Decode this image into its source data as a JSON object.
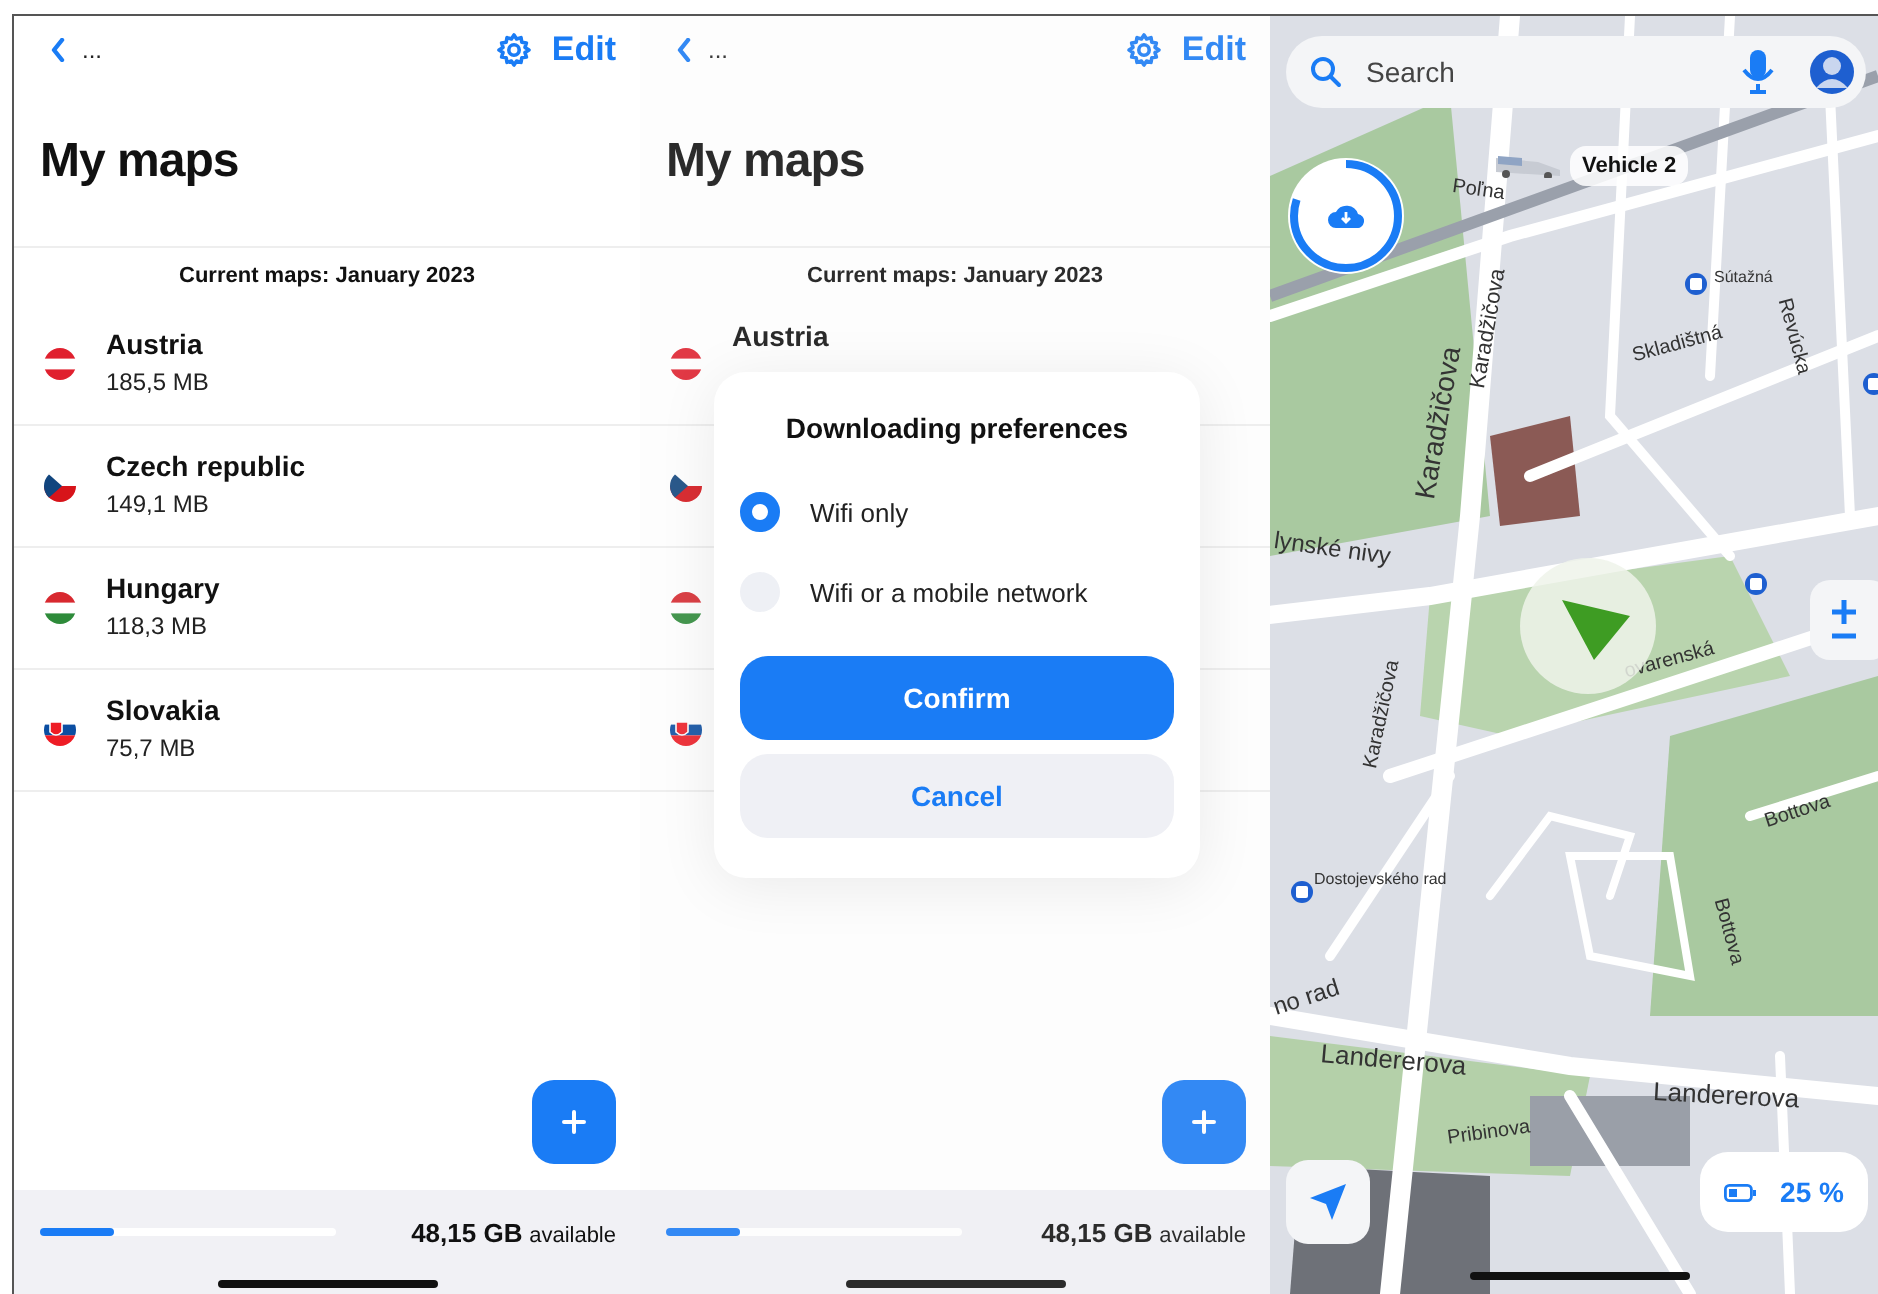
{
  "screens": [
    {
      "kind": "maps_list",
      "back_label": "...",
      "edit": "Edit",
      "title": "My maps",
      "section": "Current maps: January 2023",
      "maps": [
        {
          "kind": "full",
          "name": "Austria",
          "size": "185,5 MB"
        },
        {
          "kind": "full",
          "name": "Czech republic",
          "size": "149,1 MB"
        },
        {
          "kind": "full",
          "name": "Hungary",
          "size": "118,3 MB"
        },
        {
          "kind": "full",
          "name": "Slovakia",
          "size": "75,7 MB"
        }
      ],
      "storage": {
        "level": 0.25,
        "amount": "48,15 GB",
        "suffix": "available"
      }
    },
    {
      "kind": "maps_list",
      "back_label": "...",
      "edit": "Edit",
      "title": "My maps",
      "section": "Current maps: January 2023",
      "maps": [
        {
          "kind": "name_only",
          "name": "Austria"
        },
        {
          "kind": "flag_only"
        },
        {
          "kind": "flag_only"
        },
        {
          "kind": "flag_only"
        }
      ],
      "storage": {
        "level": 0.25,
        "amount": "48,15 GB",
        "suffix": "available"
      },
      "dialog": {
        "title": "Downloading preferences",
        "options": [
          {
            "label": "Wifi only",
            "selected": true
          },
          {
            "label": "Wifi or a mobile network",
            "selected": false
          }
        ],
        "confirm": "Confirm",
        "cancel": "Cancel"
      }
    },
    {
      "kind": "map",
      "search": {
        "placeholder": "Search"
      },
      "download": {
        "level": 0.8
      },
      "vehicle": "Vehicle 2",
      "battery": "25 %",
      "labels": [
        "Poľna",
        "Sútažná",
        "Revúcka",
        "Skladištná",
        "Karadžičova",
        "Karadžičova",
        "lynské nivy",
        "ovarenská",
        "Karadžičova",
        "Bottova",
        "Bottova",
        "Dostojevského rad",
        "no rad",
        "Landererova",
        "Landererova",
        "Pribinova"
      ]
    }
  ]
}
